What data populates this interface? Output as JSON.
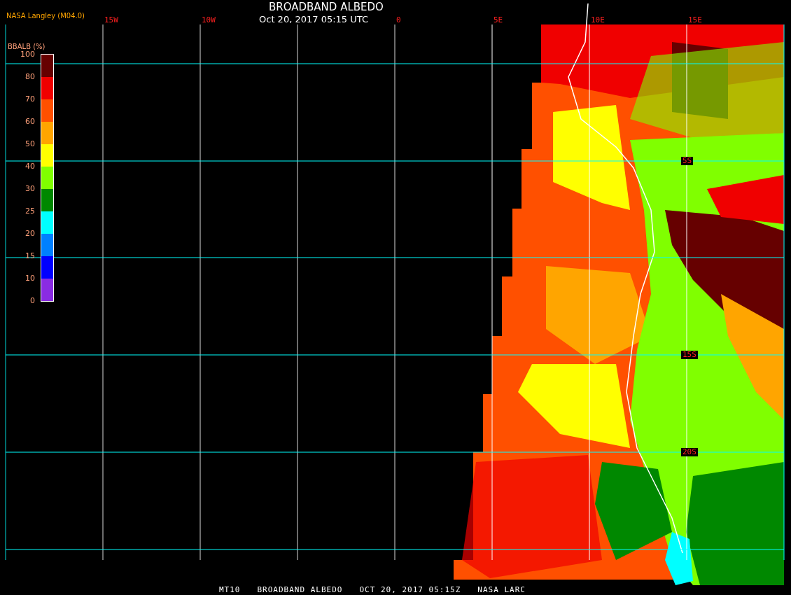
{
  "header": {
    "source": "NASA Langley (M04.0)",
    "title": "BROADBAND ALBEDO",
    "time": "Oct 20, 2017 05:15 UTC"
  },
  "longitude_labels": [
    "15W",
    "10W",
    "0",
    "5E",
    "10E",
    "15E"
  ],
  "latitude_labels": [
    "5S",
    "15S",
    "20S"
  ],
  "legend": {
    "title": "BBALB (%)",
    "ticks": [
      "100",
      "80",
      "70",
      "60",
      "50",
      "40",
      "30",
      "25",
      "20",
      "15",
      "10",
      "0"
    ],
    "segments": [
      {
        "color": "#660000"
      },
      {
        "color": "#f00000"
      },
      {
        "color": "#ff5000"
      },
      {
        "color": "#ffa500"
      },
      {
        "color": "#ffff00"
      },
      {
        "color": "#80ff00"
      },
      {
        "color": "#008800"
      },
      {
        "color": "#00ffff"
      },
      {
        "color": "#0080ff"
      },
      {
        "color": "#0000ff"
      },
      {
        "color": "#8a2be2"
      }
    ]
  },
  "footer": [
    "MT10",
    "BROADBAND ALBEDO",
    "OCT 20, 2017 05:15Z",
    "NASA LARC"
  ]
}
